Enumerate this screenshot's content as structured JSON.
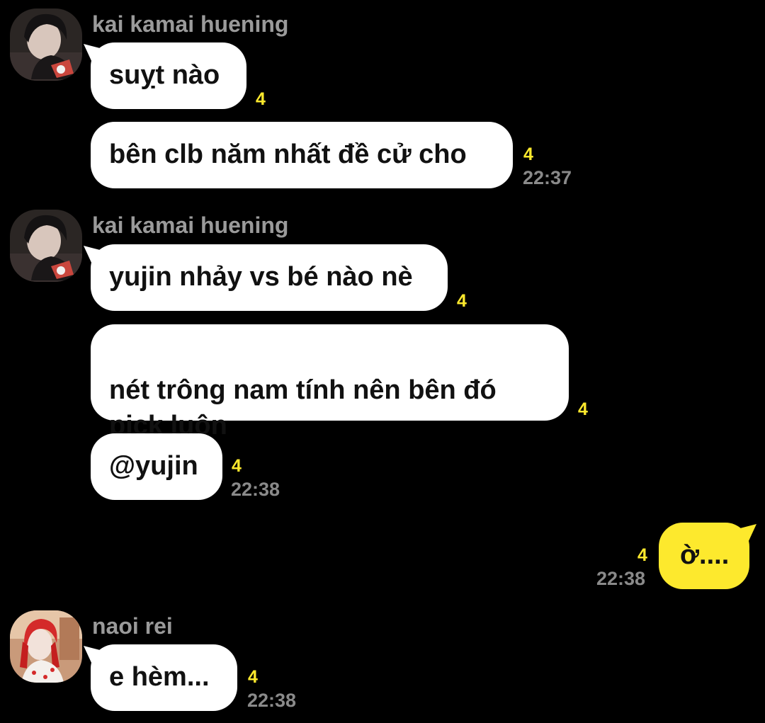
{
  "messages": [
    {
      "sender": "kai kamai huening",
      "lines": [
        "suỵt nào",
        "bên clb năm nhất đề cử cho"
      ],
      "unread": [
        "4",
        "4"
      ],
      "time": "22:37"
    },
    {
      "sender": "kai kamai huening",
      "lines": [
        "yujin nhảy vs bé nào nè",
        "nét trông nam tính nên bên đó\npick luôn",
        "@yujin"
      ],
      "unread": [
        "4",
        "4",
        "4"
      ],
      "time": "22:38"
    },
    {
      "sender": "me",
      "lines": [
        "ờ...."
      ],
      "unread": [
        "4"
      ],
      "time": "22:38"
    },
    {
      "sender": "naoi rei",
      "lines": [
        "e hèm..."
      ],
      "unread": [
        "4"
      ],
      "time": "22:38"
    }
  ],
  "colors": {
    "background": "#000000",
    "incoming_bubble": "#ffffff",
    "outgoing_bubble": "#fde92d",
    "unread_count": "#fde92d",
    "meta_text": "#8a8a8a"
  },
  "icons": {
    "avatar_kai": "profile-photo-dark-haired-person",
    "avatar_rei": "profile-photo-red-hat-person"
  }
}
